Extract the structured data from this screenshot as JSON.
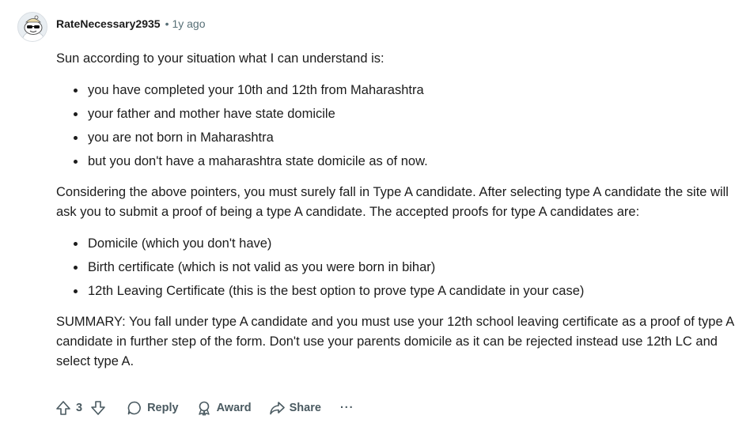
{
  "comment": {
    "author": "RateNecessary2935",
    "separator": "•",
    "time": "1y ago",
    "paragraphs": {
      "intro": "Sun according to your situation what I can understand is:",
      "considering": "Considering the above pointers, you must surely fall in Type A candidate. After selecting type A candidate the site will ask you to submit a proof of being a type A candidate. The accepted proofs for type A candidates are:",
      "summary": "SUMMARY: You fall under type A candidate and you must use your 12th school leaving certificate as a proof of type A candidate in further step of the form. Don't use your parents domicile as it can be rejected instead use 12th LC and select type A."
    },
    "situation_list": [
      "you have completed your 10th and 12th from Maharashtra",
      "your father and mother have state domicile",
      "you are not born in Maharashtra",
      "but you don't have a maharashtra state domicile as of now."
    ],
    "proofs_list": [
      "Domicile (which you don't have)",
      "Birth certificate (which is not valid as you were born in bihar)",
      "12th Leaving Certificate (this is the best option to prove type A candidate in your case)"
    ]
  },
  "actions": {
    "upvote_icon": "upvote-arrow-icon",
    "vote_count": "3",
    "downvote_icon": "downvote-arrow-icon",
    "reply_label": "Reply",
    "award_label": "Award",
    "share_label": "Share",
    "more_label": "···"
  },
  "colors": {
    "text": "#1c1c1c",
    "muted": "#576f76",
    "action": "#4a5a61",
    "background": "#ffffff"
  }
}
